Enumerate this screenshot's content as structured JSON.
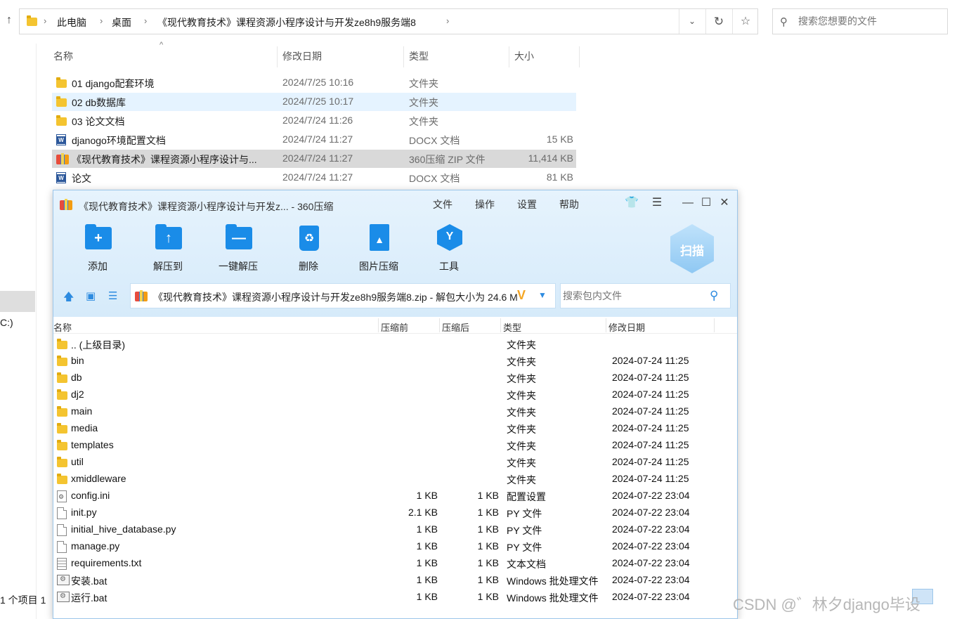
{
  "explorer": {
    "breadcrumbs": [
      "此电脑",
      "桌面",
      "《现代教育技术》课程资源小程序设计与开发ze8h9服务端8"
    ],
    "search_placeholder": "搜索您想要的文件",
    "columns": {
      "name": "名称",
      "date": "修改日期",
      "type": "类型",
      "size": "大小"
    },
    "files": [
      {
        "name": "01 django配套环境",
        "date": "2024/7/25 10:16",
        "type": "文件夹",
        "size": "",
        "icon": "folder-icon",
        "state": "normal"
      },
      {
        "name": "02 db数据库",
        "date": "2024/7/25 10:17",
        "type": "文件夹",
        "size": "",
        "icon": "folder-icon",
        "state": "hover"
      },
      {
        "name": "03 论文文档",
        "date": "2024/7/24 11:26",
        "type": "文件夹",
        "size": "",
        "icon": "folder-icon",
        "state": "normal"
      },
      {
        "name": "djanogo环境配置文档",
        "date": "2024/7/24 11:27",
        "type": "DOCX 文档",
        "size": "15 KB",
        "icon": "word-icon",
        "state": "normal"
      },
      {
        "name": "《现代教育技术》课程资源小程序设计与...",
        "date": "2024/7/24 11:27",
        "type": "360压缩 ZIP 文件",
        "size": "11,414 KB",
        "icon": "zip-icon",
        "state": "selected"
      },
      {
        "name": "论文",
        "date": "2024/7/24 11:27",
        "type": "DOCX 文档",
        "size": "81 KB",
        "icon": "word-icon",
        "state": "normal"
      }
    ],
    "nav_drive_label": "C:)",
    "status_count": "1 个项目  1"
  },
  "zip_window": {
    "title": "《现代教育技术》课程资源小程序设计与开发z... - 360压缩",
    "menu": [
      "文件",
      "操作",
      "设置",
      "帮助"
    ],
    "window_buttons": {
      "skin": "👕",
      "feedback": "☰",
      "minimize": "—",
      "maximize": "☐",
      "close": "✕"
    },
    "toolbar": [
      {
        "label": "添加",
        "glyph": "+",
        "icon": "add-icon"
      },
      {
        "label": "解压到",
        "glyph": "↑",
        "icon": "extract-to-icon"
      },
      {
        "label": "一键解压",
        "glyph": "—",
        "icon": "one-click-extract-icon"
      },
      {
        "label": "删除",
        "glyph": "♻",
        "icon": "delete-icon"
      },
      {
        "label": "图片压缩",
        "glyph": "▲",
        "icon": "image-compress-icon"
      },
      {
        "label": "工具",
        "glyph": "Y",
        "icon": "tools-icon"
      }
    ],
    "scan_label": "扫描",
    "path_text": "《现代教育技术》课程资源小程序设计与开发ze8h9服务端8.zip - 解包大小为 24.6 M",
    "search_placeholder": "搜索包内文件",
    "columns": {
      "name": "名称",
      "packed": "压缩前",
      "compressed": "压缩后",
      "type": "类型",
      "date": "修改日期"
    },
    "rows": [
      {
        "name": ".. (上级目录)",
        "packed": "",
        "compressed": "",
        "type": "文件夹",
        "date": "",
        "icon": "folder-icon"
      },
      {
        "name": "bin",
        "packed": "",
        "compressed": "",
        "type": "文件夹",
        "date": "2024-07-24 11:25",
        "icon": "folder-icon"
      },
      {
        "name": "db",
        "packed": "",
        "compressed": "",
        "type": "文件夹",
        "date": "2024-07-24 11:25",
        "icon": "folder-icon"
      },
      {
        "name": "dj2",
        "packed": "",
        "compressed": "",
        "type": "文件夹",
        "date": "2024-07-24 11:25",
        "icon": "folder-icon"
      },
      {
        "name": "main",
        "packed": "",
        "compressed": "",
        "type": "文件夹",
        "date": "2024-07-24 11:25",
        "icon": "folder-icon"
      },
      {
        "name": "media",
        "packed": "",
        "compressed": "",
        "type": "文件夹",
        "date": "2024-07-24 11:25",
        "icon": "folder-icon"
      },
      {
        "name": "templates",
        "packed": "",
        "compressed": "",
        "type": "文件夹",
        "date": "2024-07-24 11:25",
        "icon": "folder-icon"
      },
      {
        "name": "util",
        "packed": "",
        "compressed": "",
        "type": "文件夹",
        "date": "2024-07-24 11:25",
        "icon": "folder-icon"
      },
      {
        "name": "xmiddleware",
        "packed": "",
        "compressed": "",
        "type": "文件夹",
        "date": "2024-07-24 11:25",
        "icon": "folder-icon"
      },
      {
        "name": "config.ini",
        "packed": "1 KB",
        "compressed": "1 KB",
        "type": "配置设置",
        "date": "2024-07-22 23:04",
        "icon": "config-file-icon"
      },
      {
        "name": "init.py",
        "packed": "2.1 KB",
        "compressed": "1 KB",
        "type": "PY 文件",
        "date": "2024-07-22 23:04",
        "icon": "file-icon"
      },
      {
        "name": "initial_hive_database.py",
        "packed": "1 KB",
        "compressed": "1 KB",
        "type": "PY 文件",
        "date": "2024-07-22 23:04",
        "icon": "file-icon"
      },
      {
        "name": "manage.py",
        "packed": "1 KB",
        "compressed": "1 KB",
        "type": "PY 文件",
        "date": "2024-07-22 23:04",
        "icon": "file-icon"
      },
      {
        "name": "requirements.txt",
        "packed": "1 KB",
        "compressed": "1 KB",
        "type": "文本文档",
        "date": "2024-07-22 23:04",
        "icon": "text-file-icon"
      },
      {
        "name": "安装.bat",
        "packed": "1 KB",
        "compressed": "1 KB",
        "type": "Windows 批处理文件",
        "date": "2024-07-22 23:04",
        "icon": "batch-file-icon"
      },
      {
        "name": "运行.bat",
        "packed": "1 KB",
        "compressed": "1 KB",
        "type": "Windows 批处理文件",
        "date": "2024-07-22 23:04",
        "icon": "batch-file-icon"
      }
    ]
  },
  "watermark": "CSDN @゛林夕django毕设"
}
